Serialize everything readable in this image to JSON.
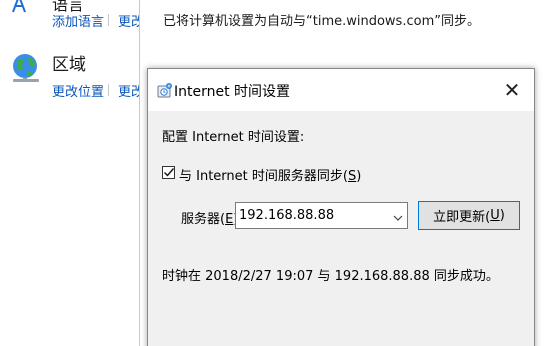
{
  "control_panel": {
    "language": {
      "title": "语言",
      "links": [
        "添加语言",
        "更改"
      ]
    },
    "region": {
      "title": "区域",
      "links": [
        "更改位置",
        "更改"
      ]
    }
  },
  "date_time_dialog": {
    "sync_text": "已将计算机设置为自动与“time.windows.com”同步。"
  },
  "internet_time_dialog": {
    "title": "Internet 时间设置",
    "close_glyph": "✕",
    "config_label": "配置 Internet 时间设置:",
    "sync_checkbox": {
      "checked": true,
      "label": "与 Internet 时间服务器同步(",
      "mnemonic": "S",
      "label_end": ")"
    },
    "server": {
      "label": "服务器(",
      "mnemonic": "E",
      "label_end": "):",
      "value": "192.168.88.88"
    },
    "update_button": {
      "label": "立即更新(",
      "mnemonic": "U",
      "label_end": ")"
    },
    "status": "时钟在 2018/2/27 19:07 与 192.168.88.88 同步成功。"
  },
  "colors": {
    "link": "#0b57b8",
    "dialog_bg": "#f0f0f0",
    "button_focus_border": "#0078d7"
  }
}
